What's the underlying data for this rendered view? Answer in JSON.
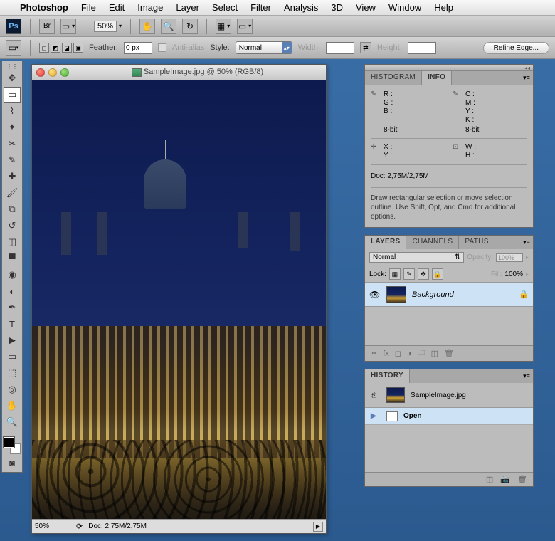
{
  "menubar": {
    "app": "Photoshop",
    "items": [
      "File",
      "Edit",
      "Image",
      "Layer",
      "Select",
      "Filter",
      "Analysis",
      "3D",
      "View",
      "Window",
      "Help"
    ]
  },
  "toolbar": {
    "ps_label": "Ps",
    "br_label": "Br",
    "zoom": "50%"
  },
  "options_bar": {
    "feather_label": "Feather:",
    "feather_value": "0 px",
    "antialias_label": "Anti-alias",
    "style_label": "Style:",
    "style_value": "Normal",
    "width_label": "Width:",
    "height_label": "Height:",
    "refine_label": "Refine Edge..."
  },
  "document": {
    "title": "SampleImage.jpg @ 50% (RGB/8)",
    "status_zoom": "50%",
    "status_doc": "Doc: 2,75M/2,75M"
  },
  "info_panel": {
    "tabs": {
      "histogram": "HISTOGRAM",
      "info": "INFO"
    },
    "rgb": {
      "r": "R :",
      "g": "G :",
      "b": "B :"
    },
    "cmyk": {
      "c": "C :",
      "m": "M :",
      "y": "Y :",
      "k": "K :"
    },
    "bit": "8-bit",
    "xy": {
      "x": "X :",
      "y": "Y :"
    },
    "wh": {
      "w": "W :",
      "h": "H :"
    },
    "doc": "Doc: 2,75M/2,75M",
    "hint": "Draw rectangular selection or move selection outline.  Use Shift, Opt, and Cmd for additional options."
  },
  "layers_panel": {
    "tabs": {
      "layers": "LAYERS",
      "channels": "CHANNELS",
      "paths": "PATHS"
    },
    "blend_mode": "Normal",
    "opacity_label": "Opacity:",
    "opacity_value": "100%",
    "lock_label": "Lock:",
    "fill_label": "Fill:",
    "fill_value": "100%",
    "layer_name": "Background"
  },
  "history_panel": {
    "tab": "HISTORY",
    "doc_name": "SampleImage.jpg",
    "item": "Open"
  }
}
